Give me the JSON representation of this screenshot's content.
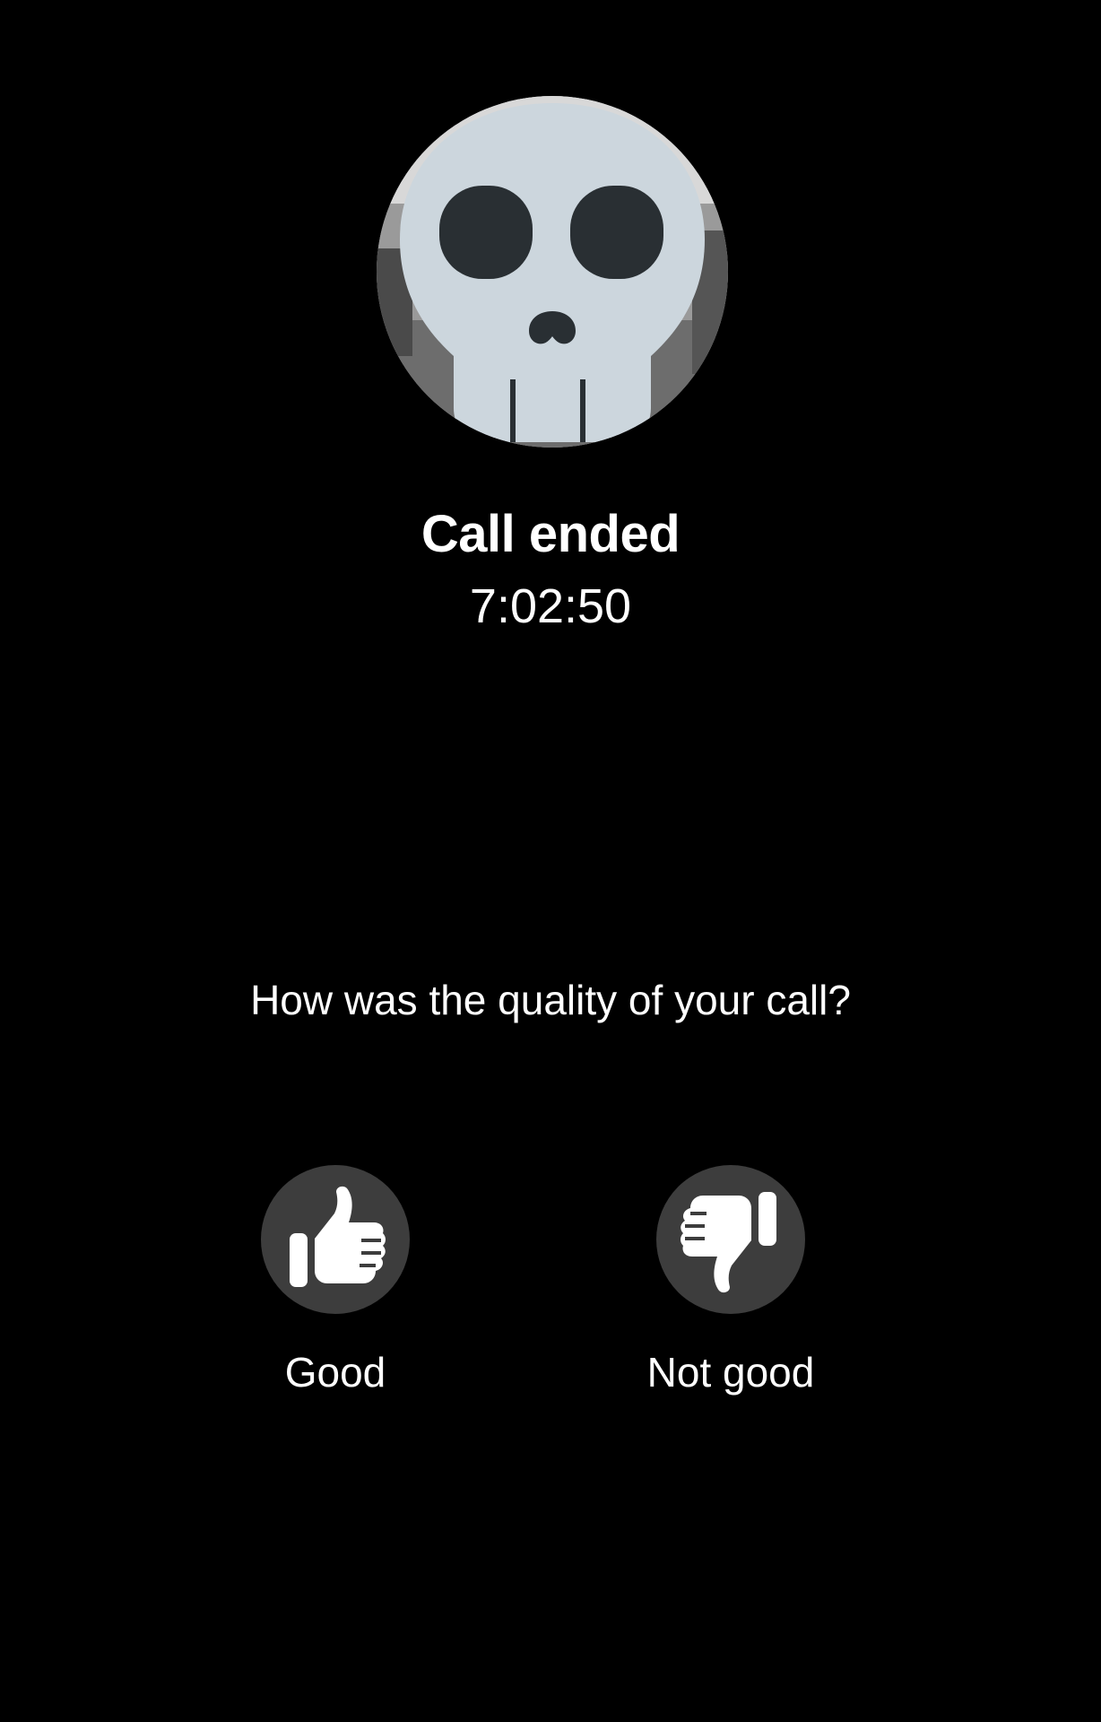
{
  "call": {
    "status": "Call ended",
    "duration": "7:02:50"
  },
  "feedback": {
    "question": "How was the quality of your call?",
    "good_label": "Good",
    "bad_label": "Not good"
  },
  "icons": {
    "avatar": "skull-icon",
    "good": "thumbs-up-icon",
    "bad": "thumbs-down-icon"
  },
  "colors": {
    "background": "#000000",
    "button_bg": "#3d3d3d",
    "skull": "#ccd6dd",
    "skull_features": "#292f33",
    "text": "#ffffff"
  }
}
